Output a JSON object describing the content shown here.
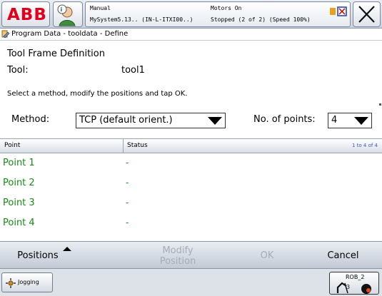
{
  "header": {
    "logo": "ABB",
    "mode": "Manual",
    "system": "MySystem5.13.. (IN-L-ITXI00..)",
    "motors": "Motors On",
    "state": "Stopped (2 of 2) (Speed 100%)"
  },
  "title": "Program Data - tooldata - Define",
  "form": {
    "heading": "Tool Frame Definition",
    "tool_label": "Tool:",
    "tool_value": "tool1",
    "instruction": "Select a method, modify the positions and tap OK.",
    "method_label": "Method:",
    "method_value": "TCP (default orient.)",
    "points_label": "No. of points:",
    "points_value": "4"
  },
  "table": {
    "columns": [
      "Point",
      "Status"
    ],
    "count": "1 to 4 of 4",
    "rows": [
      {
        "point": "Point 1",
        "status": "-"
      },
      {
        "point": "Point 2",
        "status": "-"
      },
      {
        "point": "Point 3",
        "status": "-"
      },
      {
        "point": "Point 4",
        "status": "-"
      }
    ]
  },
  "commands": {
    "positions": "Positions",
    "modify_line1": "Modify",
    "modify_line2": "Position",
    "ok": "OK",
    "cancel": "Cancel"
  },
  "taskbar": {
    "jogging": "Jogging",
    "robot": "ROB_2"
  },
  "colors": {
    "abb_red": "#e2001a",
    "point_green": "#178a17",
    "disabled_gray": "#a6adb8"
  },
  "icons": [
    "user-icon",
    "close-icon",
    "program-data-icon",
    "jogging-icon",
    "robot-icon",
    "dropdown-arrow-icon"
  ]
}
